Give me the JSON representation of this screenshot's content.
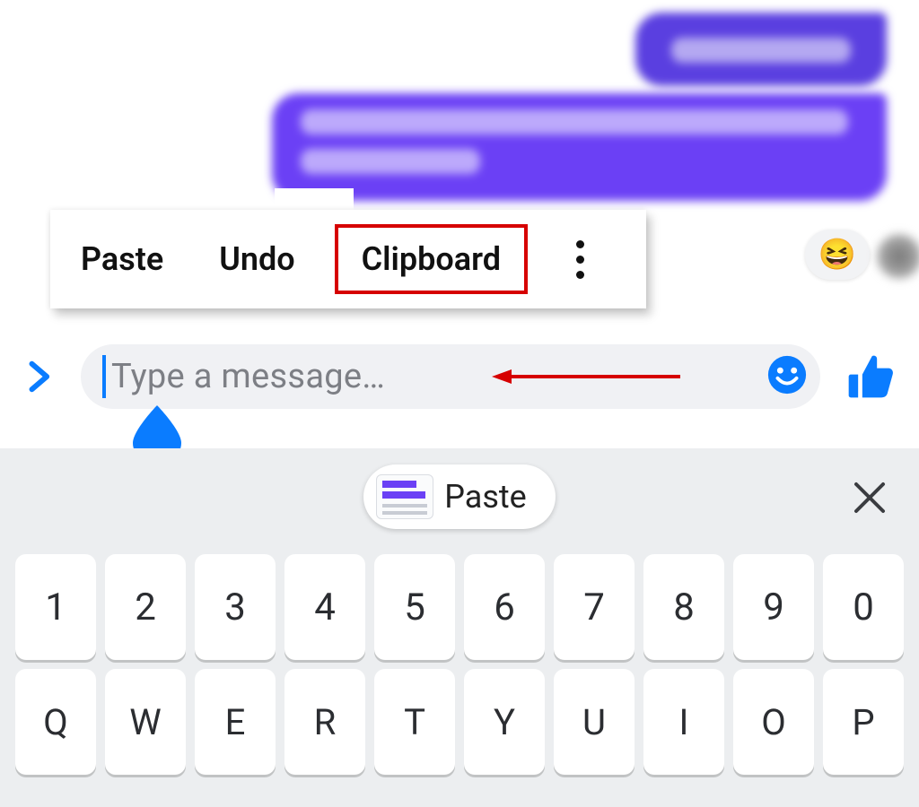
{
  "context_menu": {
    "paste": "Paste",
    "undo": "Undo",
    "clipboard": "Clipboard"
  },
  "reaction_emoji": "😆",
  "input": {
    "placeholder": "Type a message…"
  },
  "keyboard": {
    "paste_chip": "Paste",
    "row_numbers": [
      "1",
      "2",
      "3",
      "4",
      "5",
      "6",
      "7",
      "8",
      "9",
      "0"
    ],
    "row_letters": [
      "Q",
      "W",
      "E",
      "R",
      "T",
      "Y",
      "U",
      "I",
      "O",
      "P"
    ]
  },
  "colors": {
    "accent_blue": "#0a7cff",
    "bubble_purple": "#6b40f5",
    "annotation_red": "#d60000"
  }
}
